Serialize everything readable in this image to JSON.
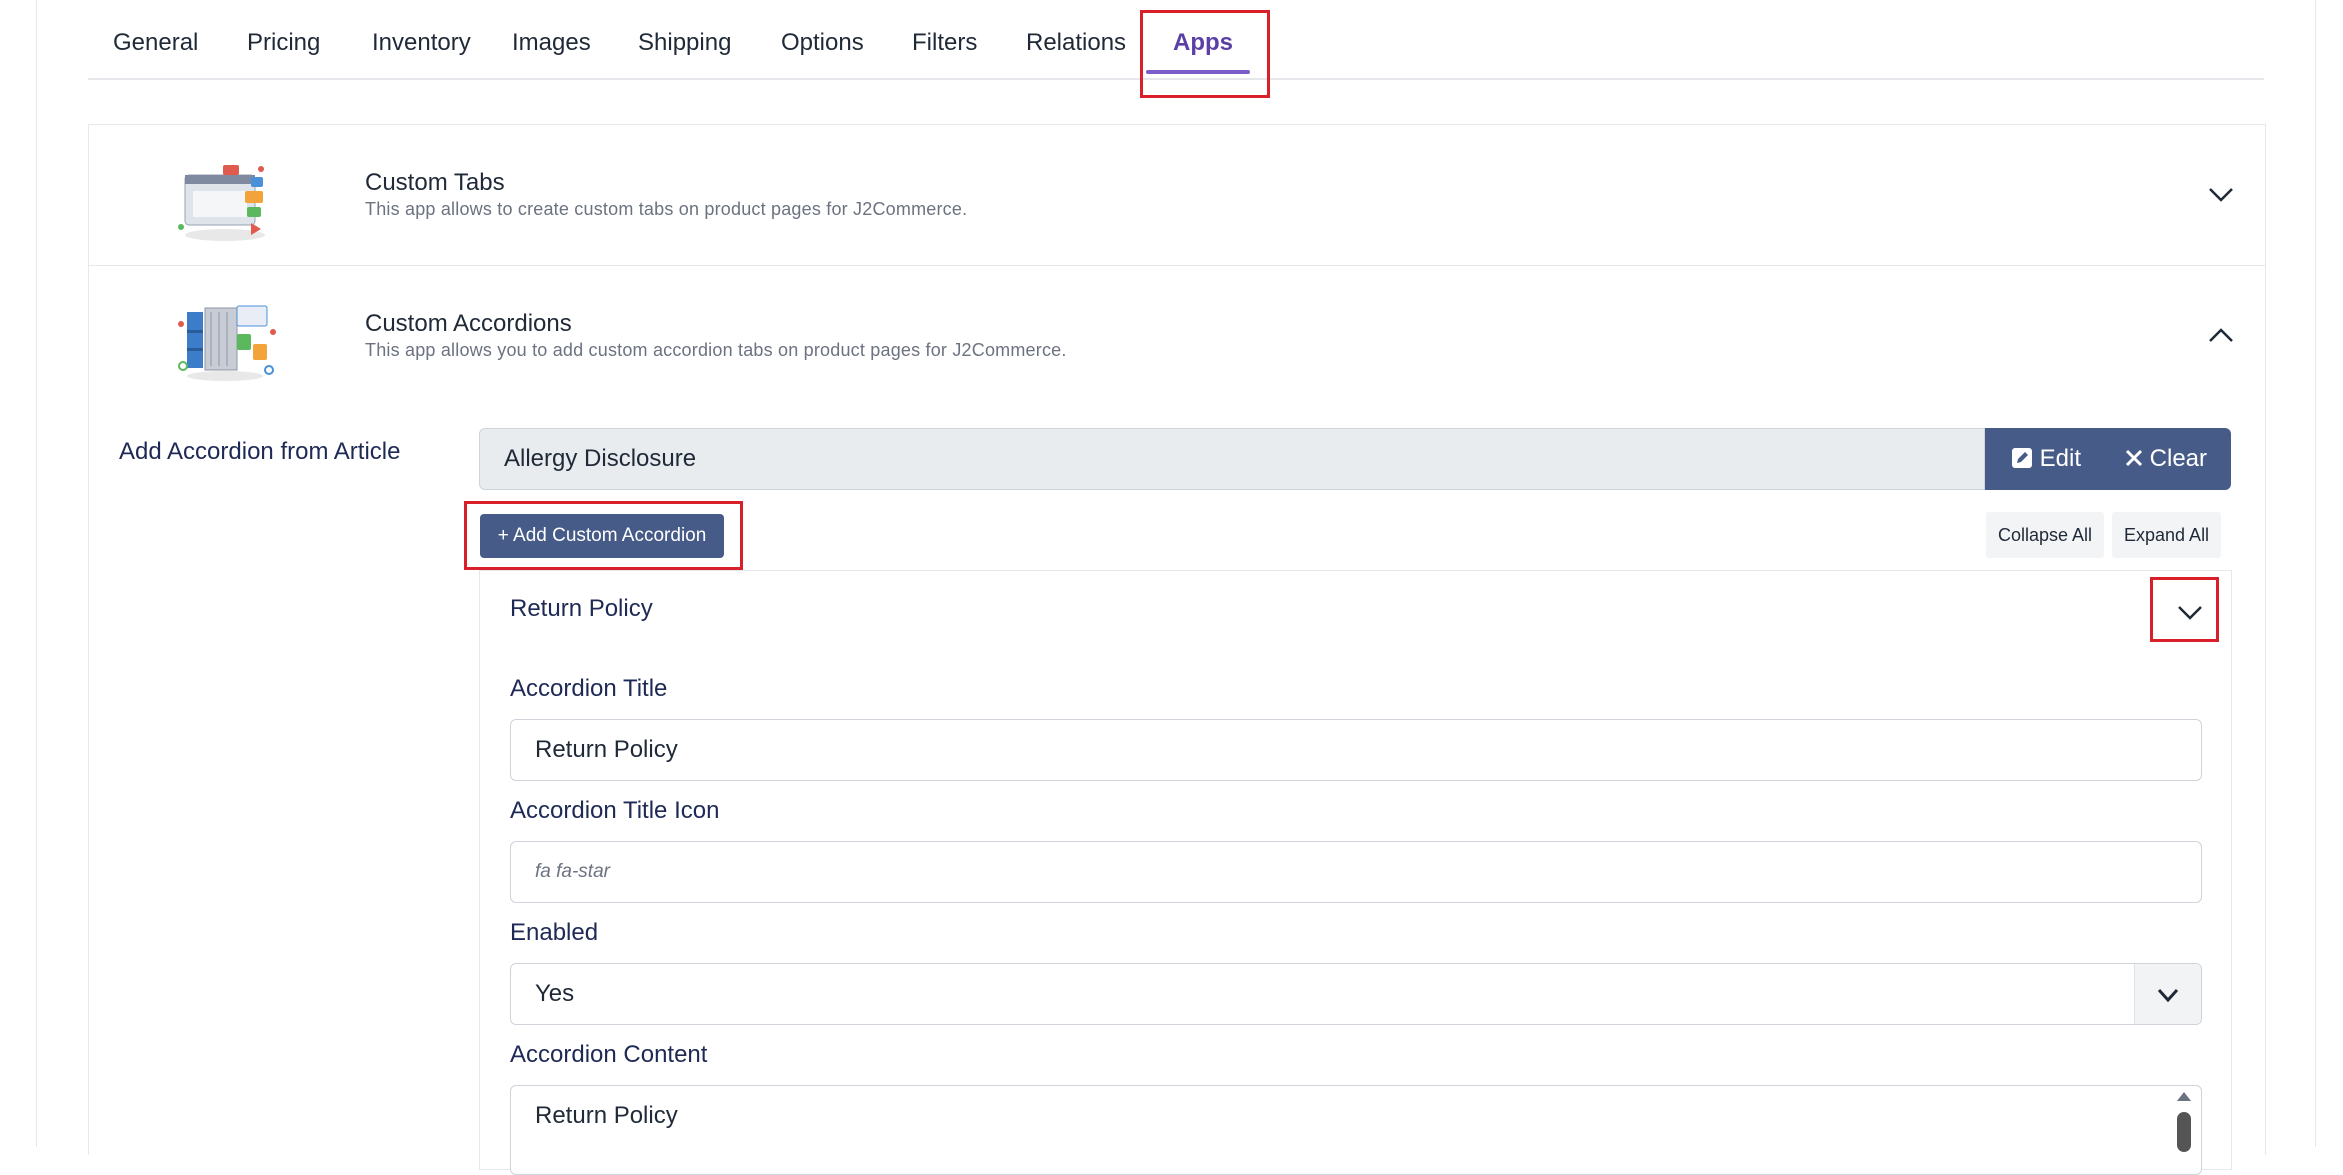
{
  "tabs": [
    "General",
    "Pricing",
    "Inventory",
    "Images",
    "Shipping",
    "Options",
    "Filters",
    "Relations",
    "Apps"
  ],
  "active_tab": "Apps",
  "apps": [
    {
      "title": "Custom Tabs",
      "description": "This app allows to create custom tabs on product pages for J2Commerce.",
      "state": "collapsed"
    },
    {
      "title": "Custom Accordions",
      "description": "This app allows you to add custom accordion tabs on product pages for J2Commerce.",
      "state": "expanded"
    }
  ],
  "article": {
    "label": "Add Accordion from Article",
    "value": "Allergy Disclosure",
    "edit_label": "Edit",
    "clear_label": "Clear"
  },
  "toolbar": {
    "add_label": "+ Add Custom Accordion",
    "collapse_all": "Collapse All",
    "expand_all": "Expand All"
  },
  "accordion_item": {
    "header": "Return Policy",
    "title_label": "Accordion Title",
    "title_value": "Return Policy",
    "icon_label": "Accordion Title Icon",
    "icon_placeholder": "fa fa-star",
    "enabled_label": "Enabled",
    "enabled_value": "Yes",
    "content_label": "Accordion Content",
    "content_value": "Return Policy"
  },
  "colors": {
    "accent_purple": "#5b3fa7",
    "button_navy": "#465b87",
    "highlight_red": "#d9202a"
  }
}
